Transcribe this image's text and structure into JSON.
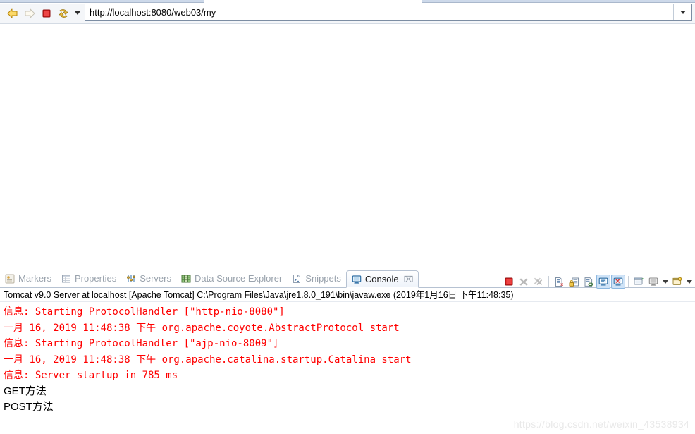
{
  "browser": {
    "toolbar": {
      "back_icon": "back-arrow-icon",
      "forward_icon": "forward-arrow-icon",
      "stop_icon": "stop-icon",
      "refresh_icon": "refresh-icon",
      "dropdown_icon": "chevron-down-icon"
    },
    "address": {
      "value": "http://localhost:8080/web03/my",
      "placeholder": "http://localhost:8080/web03/my",
      "dropdown_icon": "chevron-down-icon"
    },
    "page_content": ""
  },
  "console_view": {
    "tabs": [
      {
        "label": "Markers",
        "icon": "markers-icon",
        "active": false,
        "closable": false
      },
      {
        "label": "Properties",
        "icon": "properties-icon",
        "active": false,
        "closable": false
      },
      {
        "label": "Servers",
        "icon": "servers-icon",
        "active": false,
        "closable": false
      },
      {
        "label": "Data Source Explorer",
        "icon": "data-source-explorer-icon",
        "active": false,
        "closable": false
      },
      {
        "label": "Snippets",
        "icon": "snippets-icon",
        "active": false,
        "closable": false
      },
      {
        "label": "Console",
        "icon": "console-icon",
        "active": true,
        "closable": true,
        "close_glyph": "⌧"
      }
    ],
    "toolbar": [
      {
        "name": "terminate-button",
        "icon": "stop-square-icon",
        "enabled": true,
        "toggled": false
      },
      {
        "name": "remove-launch-button",
        "icon": "remove-x-icon",
        "enabled": false,
        "toggled": false
      },
      {
        "name": "remove-all-terminated-button",
        "icon": "remove-all-x-icon",
        "enabled": false,
        "toggled": false
      },
      {
        "name": "separator-1",
        "icon": "separator",
        "enabled": false,
        "toggled": false
      },
      {
        "name": "clear-console-button",
        "icon": "clear-console-icon",
        "enabled": true,
        "toggled": false
      },
      {
        "name": "scroll-lock-button",
        "icon": "scroll-lock-icon",
        "enabled": true,
        "toggled": false
      },
      {
        "name": "word-wrap-button",
        "icon": "word-wrap-icon",
        "enabled": true,
        "toggled": false
      },
      {
        "name": "show-console-on-output-button",
        "icon": "show-console-out-icon",
        "enabled": true,
        "toggled": true
      },
      {
        "name": "show-console-on-error-button",
        "icon": "show-console-err-icon",
        "enabled": true,
        "toggled": true
      },
      {
        "name": "separator-2",
        "icon": "separator",
        "enabled": false,
        "toggled": false
      },
      {
        "name": "pin-console-button",
        "icon": "pin-console-icon",
        "enabled": true,
        "toggled": false
      },
      {
        "name": "display-selected-console-button",
        "icon": "display-console-icon",
        "enabled": true,
        "toggled": false
      },
      {
        "name": "display-console-menu-caret",
        "icon": "chevron-down-icon",
        "enabled": true,
        "toggled": false
      },
      {
        "name": "open-console-button",
        "icon": "open-console-icon",
        "enabled": true,
        "toggled": false
      },
      {
        "name": "open-console-menu-caret",
        "icon": "chevron-down-icon",
        "enabled": true,
        "toggled": false
      }
    ],
    "header": "Tomcat v9.0 Server at localhost [Apache Tomcat] C:\\Program Files\\Java\\jre1.8.0_191\\bin\\javaw.exe (2019年1月16日 下午11:48:35)",
    "output_lines": [
      {
        "text": "信息: Starting ProtocolHandler [\"http-nio-8080\"]",
        "stream": "err"
      },
      {
        "text": "一月 16, 2019 11:48:38 下午 org.apache.coyote.AbstractProtocol start",
        "stream": "err"
      },
      {
        "text": "信息: Starting ProtocolHandler [\"ajp-nio-8009\"]",
        "stream": "err"
      },
      {
        "text": "一月 16, 2019 11:48:38 下午 org.apache.catalina.startup.Catalina start",
        "stream": "err"
      },
      {
        "text": "信息: Server startup in 785 ms",
        "stream": "err"
      },
      {
        "text": "GET方法",
        "stream": "out"
      },
      {
        "text": "POST方法",
        "stream": "out"
      }
    ]
  },
  "watermark": "https://blog.csdn.net/weixin_43538934",
  "colors": {
    "error_text": "#ff0000",
    "standard_text": "#000000",
    "toolbar_bg": "#f4f6f9",
    "tab_inactive_text": "#9aa3ad",
    "toggle_highlight": "#cfe3f7",
    "watermark": "#e9e9e9"
  }
}
